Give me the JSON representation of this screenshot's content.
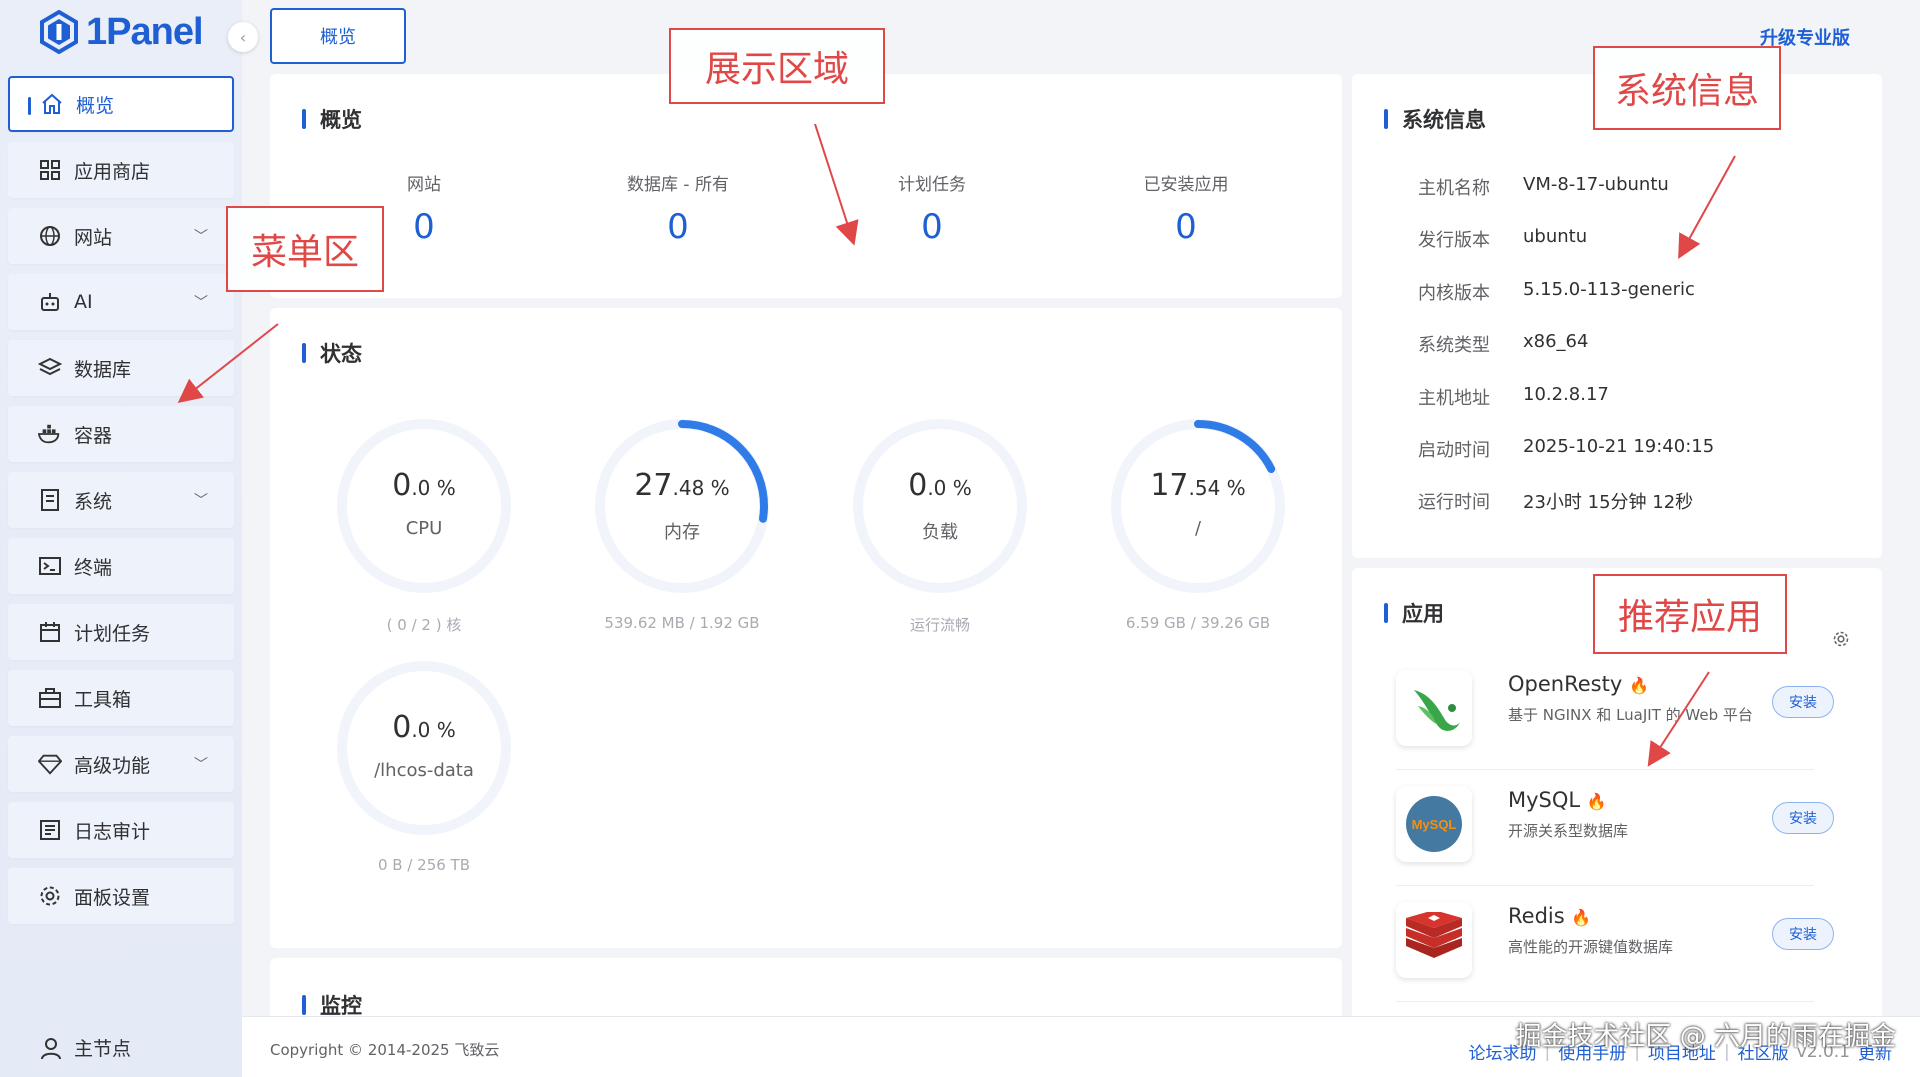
{
  "brand": {
    "name": "1Panel"
  },
  "sidebar": {
    "items": [
      {
        "label": "概览",
        "icon": "home-icon",
        "active": true
      },
      {
        "label": "应用商店",
        "icon": "grid-icon"
      },
      {
        "label": "网站",
        "icon": "globe-icon",
        "expandable": true
      },
      {
        "label": "AI",
        "icon": "robot-icon",
        "expandable": true
      },
      {
        "label": "数据库",
        "icon": "layers-icon"
      },
      {
        "label": "容器",
        "icon": "docker-icon"
      },
      {
        "label": "系统",
        "icon": "file-icon",
        "expandable": true
      },
      {
        "label": "终端",
        "icon": "terminal-icon"
      },
      {
        "label": "计划任务",
        "icon": "calendar-icon"
      },
      {
        "label": "工具箱",
        "icon": "toolbox-icon"
      },
      {
        "label": "高级功能",
        "icon": "diamond-icon",
        "expandable": true
      },
      {
        "label": "日志审计",
        "icon": "log-icon"
      },
      {
        "label": "面板设置",
        "icon": "gear-icon"
      }
    ],
    "node_label": "主节点"
  },
  "topbar": {
    "tab": "概览",
    "upgrade": "升级专业版"
  },
  "overview": {
    "title": "概览",
    "stats": [
      {
        "label": "网站",
        "value": "0"
      },
      {
        "label": "数据库 - 所有",
        "value": "0"
      },
      {
        "label": "计划任务",
        "value": "0"
      },
      {
        "label": "已安装应用",
        "value": "0"
      }
    ]
  },
  "status": {
    "title": "状态",
    "gauges": [
      {
        "int": "0",
        "dec": ".0 %",
        "label": "CPU",
        "sub": "( 0 / 2 ) 核",
        "percent": 0.0
      },
      {
        "int": "27",
        "dec": ".48 %",
        "label": "内存",
        "sub": "539.62 MB / 1.92 GB",
        "percent": 27.48
      },
      {
        "int": "0",
        "dec": ".0 %",
        "label": "负载",
        "sub": "运行流畅",
        "percent": 0.0
      },
      {
        "int": "17",
        "dec": ".54 %",
        "label": "/",
        "sub": "6.59 GB / 39.26 GB",
        "percent": 17.54
      },
      {
        "int": "0",
        "dec": ".0 %",
        "label": "/lhcos-data",
        "sub": "0 B / 256 TB",
        "percent": 0.0
      }
    ]
  },
  "monitor": {
    "title": "监控"
  },
  "sysinfo": {
    "title": "系统信息",
    "rows": [
      {
        "key": "主机名称",
        "value": "VM-8-17-ubuntu"
      },
      {
        "key": "发行版本",
        "value": "ubuntu"
      },
      {
        "key": "内核版本",
        "value": "5.15.0-113-generic"
      },
      {
        "key": "系统类型",
        "value": "x86_64"
      },
      {
        "key": "主机地址",
        "value": "10.2.8.17"
      },
      {
        "key": "启动时间",
        "value": "2025-10-21 19:40:15"
      },
      {
        "key": "运行时间",
        "value": "23小时 15分钟 12秒"
      }
    ]
  },
  "apps": {
    "title": "应用",
    "items": [
      {
        "name": "OpenResty",
        "desc": "基于 NGINX 和 LuaJIT 的 Web 平台",
        "button": "安装",
        "icon": "openresty-icon"
      },
      {
        "name": "MySQL",
        "desc": "开源关系型数据库",
        "button": "安装",
        "icon": "mysql-icon",
        "icon_text": "MySQL"
      },
      {
        "name": "Redis",
        "desc": "高性能的开源键值数据库",
        "button": "安装",
        "icon": "redis-icon"
      }
    ]
  },
  "annotations": {
    "display_area": "展示区域",
    "menu_area": "菜单区",
    "system_info": "系统信息",
    "recommended_apps": "推荐应用"
  },
  "footer": {
    "copyright": "Copyright © 2014-2025 飞致云",
    "links": [
      "论坛求助",
      "使用手册",
      "项目地址"
    ],
    "edition": "社区版",
    "version": "v2.0.1",
    "update": "更新"
  },
  "watermark": "掘金技术社区 @ 六月的雨在掘金",
  "colors": {
    "primary": "#1e5fd4",
    "annotation": "#e04848",
    "fire": "#f0a020",
    "redis": "#d6342c",
    "mysql": "#4479a1"
  }
}
